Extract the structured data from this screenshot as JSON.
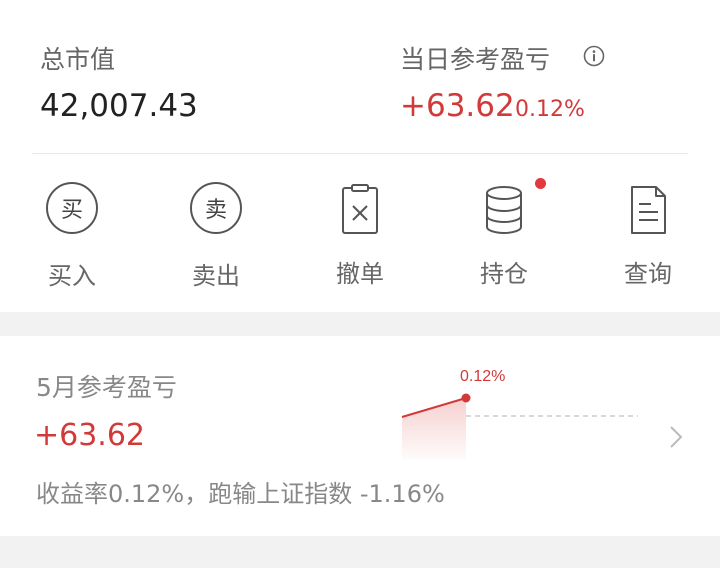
{
  "summary": {
    "total_label": "总市值",
    "total_value": "42,007.43",
    "daily_label": "当日参考盈亏",
    "daily_value": "+63.62",
    "daily_pct": "0.12%"
  },
  "actions": [
    {
      "label": "买入",
      "icon": "buy-icon",
      "glyph": "买"
    },
    {
      "label": "卖出",
      "icon": "sell-icon",
      "glyph": "卖"
    },
    {
      "label": "撤单",
      "icon": "cancel-order-icon"
    },
    {
      "label": "持仓",
      "icon": "holdings-icon"
    },
    {
      "label": "查询",
      "icon": "query-icon"
    }
  ],
  "monthly": {
    "title": "5月参考盈亏",
    "value": "+63.62",
    "description": "收益率0.12%，跑输上证指数 -1.16%",
    "chart_point_label": "0.12%"
  },
  "colors": {
    "positive": "#d23a3a",
    "badge": "#e0393e",
    "label_gray": "#666666"
  }
}
